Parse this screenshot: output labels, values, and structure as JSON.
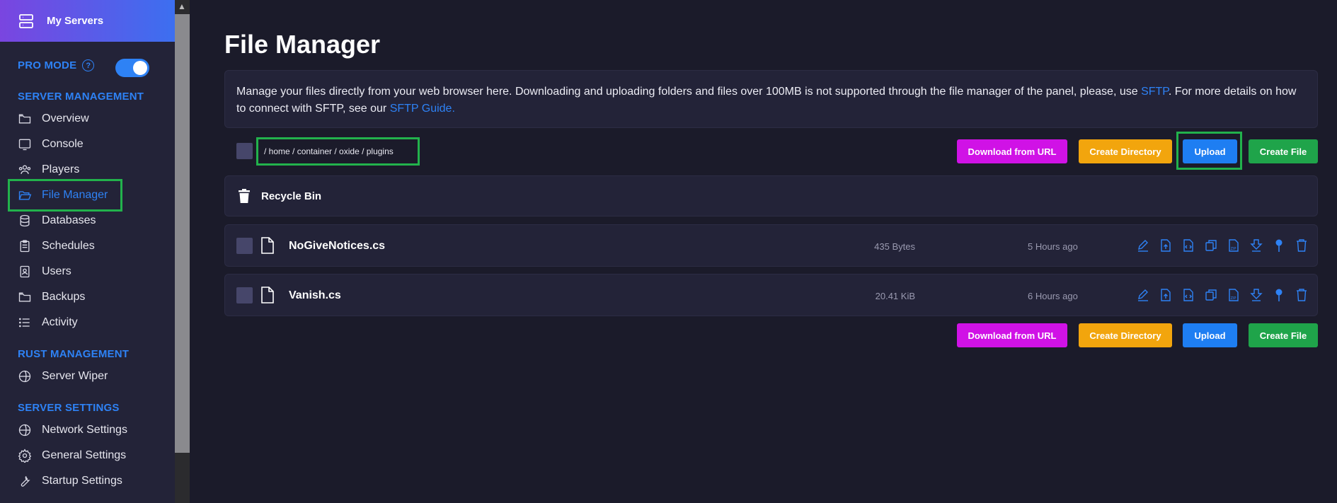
{
  "sidebar": {
    "header": "My Servers",
    "pro_mode": "PRO MODE",
    "pro_mode_help": "?",
    "sections": {
      "server_management": "SERVER MANAGEMENT",
      "rust_management": "RUST MANAGEMENT",
      "server_settings": "SERVER SETTINGS"
    },
    "items": {
      "overview": "Overview",
      "console": "Console",
      "players": "Players",
      "file_manager": "File Manager",
      "databases": "Databases",
      "schedules": "Schedules",
      "users": "Users",
      "backups": "Backups",
      "activity": "Activity",
      "server_wiper": "Server Wiper",
      "network_settings": "Network Settings",
      "general_settings": "General Settings",
      "startup_settings": "Startup Settings"
    }
  },
  "main": {
    "title": "File Manager",
    "info": {
      "part1": "Manage your files directly from your web browser here. Downloading and uploading folders and files over 100MB is not supported through the file manager of the panel, please, use ",
      "sftp_link": "SFTP",
      "part2": ". For more details on how to connect with SFTP, see our ",
      "guide_link": "SFTP Guide."
    },
    "breadcrumb": "/ home / container / oxide / plugins",
    "buttons": {
      "download_url": "Download from URL",
      "create_directory": "Create Directory",
      "upload": "Upload",
      "create_file": "Create File"
    },
    "recycle_bin": "Recycle Bin",
    "files": [
      {
        "name": "NoGiveNotices.cs",
        "size": "435 Bytes",
        "modified": "5 Hours ago"
      },
      {
        "name": "Vanish.cs",
        "size": "20.41 KiB",
        "modified": "6 Hours ago"
      }
    ]
  },
  "colors": {
    "accent": "#2e82f5",
    "highlight": "#22b24c",
    "btn_magenta": "#d012e6",
    "btn_orange": "#f2a50d",
    "btn_blue": "#1e7ef2",
    "btn_green": "#1fa44a"
  },
  "toggle": {
    "pro_mode_on": true
  }
}
